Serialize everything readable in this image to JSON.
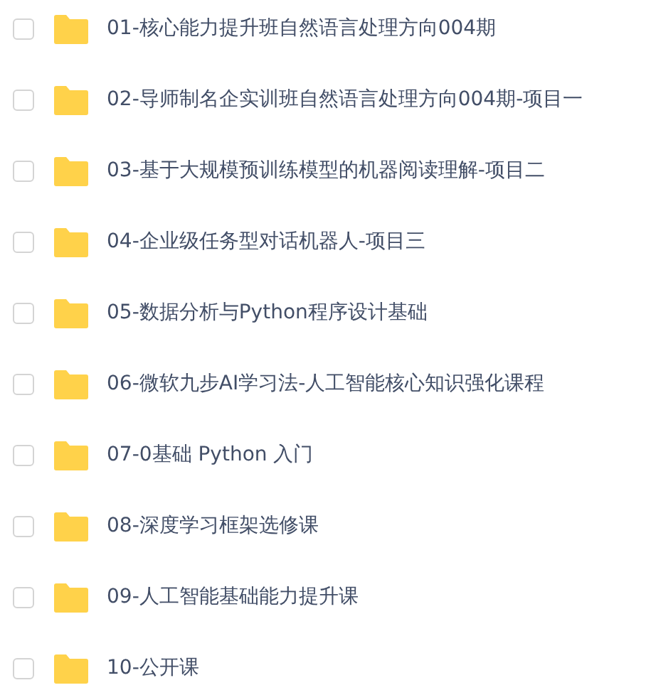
{
  "folders": [
    {
      "name": "01-核心能力提升班自然语言处理方向004期",
      "checked": false
    },
    {
      "name": "02-导师制名企实训班自然语言处理方向004期-项目一",
      "checked": false
    },
    {
      "name": "03-基于大规模预训练模型的机器阅读理解-项目二",
      "checked": false
    },
    {
      "name": "04-企业级任务型对话机器人-项目三",
      "checked": false
    },
    {
      "name": "05-数据分析与Python程序设计基础",
      "checked": false
    },
    {
      "name": "06-微软九步AI学习法-人工智能核心知识强化课程",
      "checked": false
    },
    {
      "name": "07-0基础 Python 入门",
      "checked": false
    },
    {
      "name": "08-深度学习框架选修课",
      "checked": false
    },
    {
      "name": "09-人工智能基础能力提升课",
      "checked": false
    },
    {
      "name": "10-公开课",
      "checked": false
    }
  ]
}
